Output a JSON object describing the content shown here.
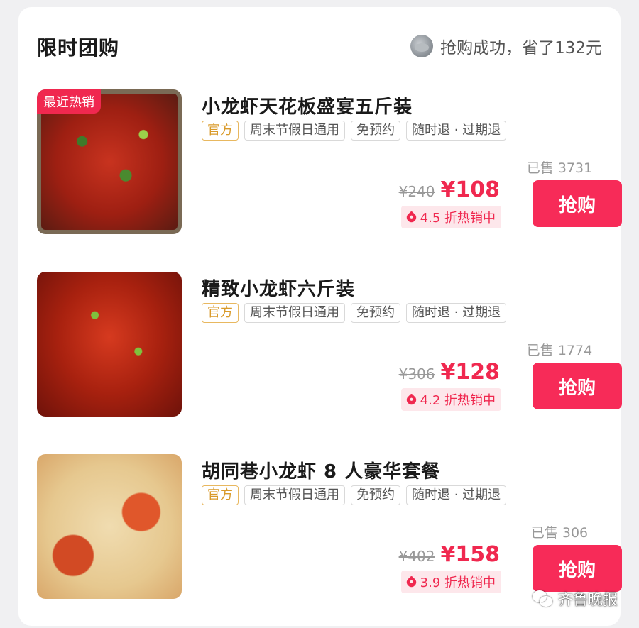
{
  "header": {
    "title": "限时团购",
    "savings_text": "抢购成功，省了132元"
  },
  "products": [
    {
      "badge": "最近热销",
      "title": "小龙虾天花板盛宴五斤装",
      "tags": [
        "官方",
        "周末节假日通用",
        "免预约",
        "随时退 · 过期退"
      ],
      "sold": "已售 3731",
      "original_price": "¥240",
      "price": "¥108",
      "discount": "4.5 折热销中",
      "buy_label": "抢购"
    },
    {
      "badge": "",
      "title": "精致小龙虾六斤装",
      "tags": [
        "官方",
        "周末节假日通用",
        "免预约",
        "随时退 · 过期退"
      ],
      "sold": "已售 1774",
      "original_price": "¥306",
      "price": "¥128",
      "discount": "4.2 折热销中",
      "buy_label": "抢购"
    },
    {
      "badge": "",
      "title": "胡同巷小龙虾 8 人豪华套餐",
      "tags": [
        "官方",
        "周末节假日通用",
        "免预约",
        "随时退 · 过期退"
      ],
      "sold": "已售 306",
      "original_price": "¥402",
      "price": "¥158",
      "discount": "3.9 折热销中",
      "buy_label": "抢购"
    }
  ],
  "watermark": "齐鲁晚报",
  "colors": {
    "accent": "#f72b58",
    "price": "#f0284f",
    "official_tag": "#d99a29"
  }
}
